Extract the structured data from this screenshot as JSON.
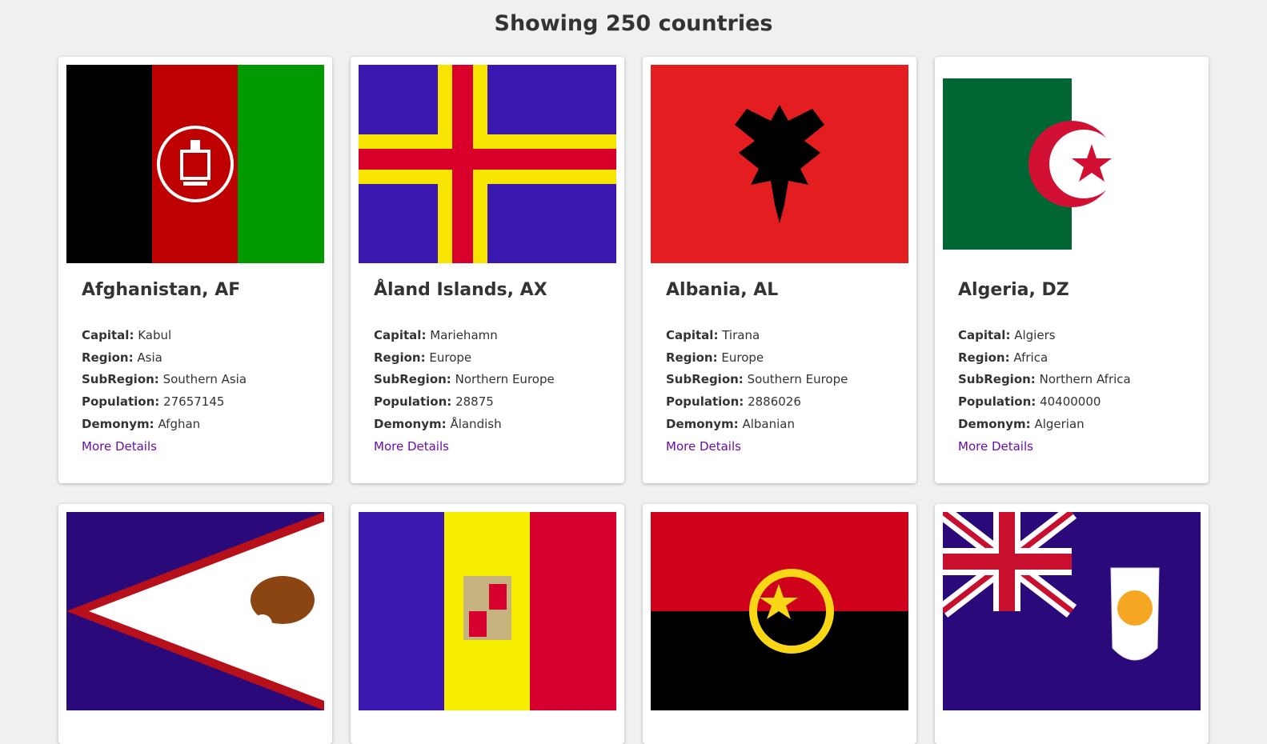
{
  "heading": "Showing 250 countries",
  "labels": {
    "capital": "Capital:",
    "region": "Region:",
    "subregion": "SubRegion:",
    "population": "Population:",
    "demonym": "Demonym:",
    "more": "More Details"
  },
  "countries": [
    {
      "name": "Afghanistan, AF",
      "capital": "Kabul",
      "region": "Asia",
      "subregion": "Southern Asia",
      "population": "27657145",
      "demonym": "Afghan"
    },
    {
      "name": "Åland Islands, AX",
      "capital": "Mariehamn",
      "region": "Europe",
      "subregion": "Northern Europe",
      "population": "28875",
      "demonym": "Ålandish"
    },
    {
      "name": "Albania, AL",
      "capital": "Tirana",
      "region": "Europe",
      "subregion": "Southern Europe",
      "population": "2886026",
      "demonym": "Albanian"
    },
    {
      "name": "Algeria, DZ",
      "capital": "Algiers",
      "region": "Africa",
      "subregion": "Northern Africa",
      "population": "40400000",
      "demonym": "Algerian"
    }
  ],
  "colors": {
    "background": "#f0f0f0",
    "link": "#6a0dad"
  }
}
